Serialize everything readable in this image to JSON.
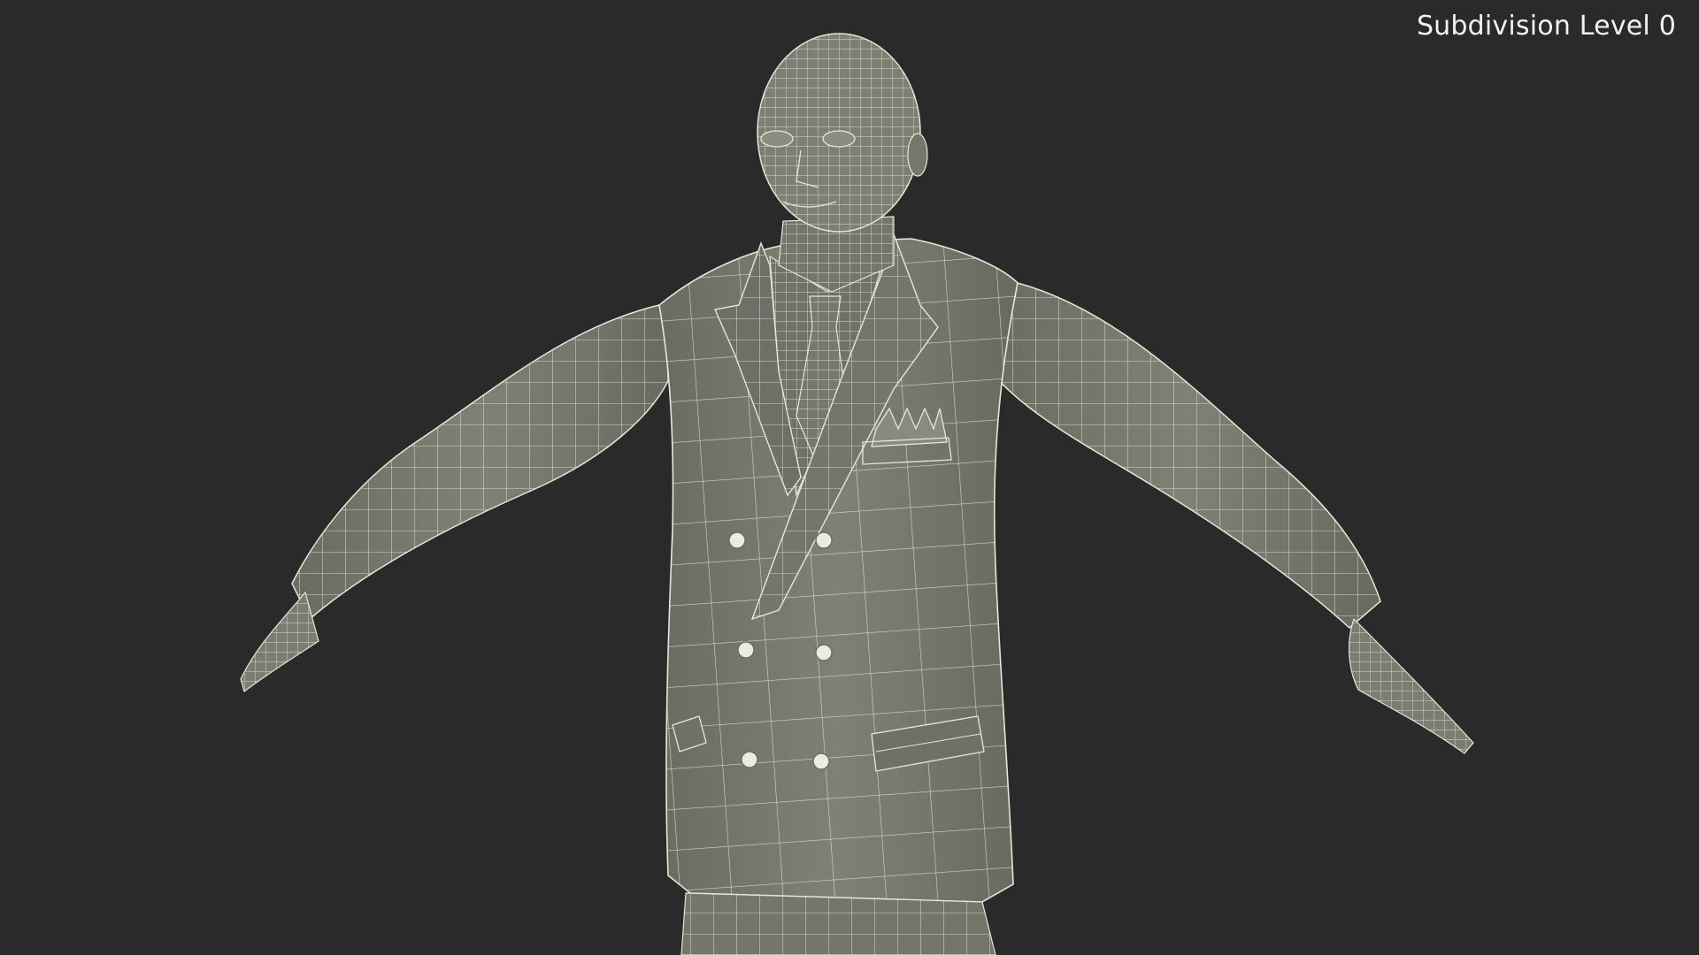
{
  "viewport": {
    "overlay_label": "Subdivision Level 0",
    "background_color": "#2a2a2a"
  },
  "model": {
    "mesh_fill_color": "#7b7c72",
    "mesh_shade_color": "#5f6058",
    "wire_color": "#e8e6d4",
    "button_color": "#ecebe2"
  }
}
